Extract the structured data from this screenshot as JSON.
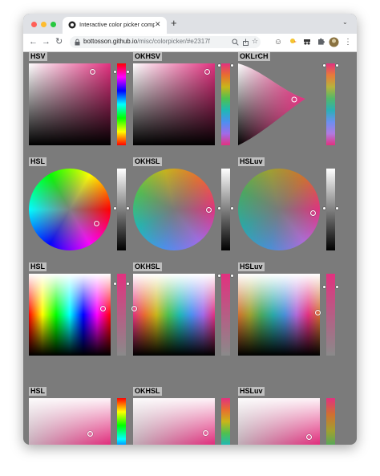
{
  "browser": {
    "tab_title": "Interactive color picker compa",
    "tab_close": "✕",
    "new_tab": "+",
    "tab_menu": "⌄",
    "url_host": "bottosson.github.io",
    "url_path": "/misc/colorpicker/#e2317f",
    "nav": {
      "back": "←",
      "forward": "→",
      "reload": "↻"
    },
    "icons": [
      "zoom-icon",
      "share-icon",
      "bookmark-star-icon",
      "smiley-extension-icon",
      "duck-extension-icon",
      "spy-extension-icon",
      "puzzle-extensions-icon",
      "avatar",
      "kebab-menu-icon"
    ]
  },
  "selected_color": "#e2317f",
  "rows": [
    {
      "panels": [
        {
          "label": "HSV"
        },
        {
          "label": "OKHSV"
        },
        {
          "label": "OKLrCH"
        }
      ]
    },
    {
      "panels": [
        {
          "label": "HSL"
        },
        {
          "label": "OKHSL"
        },
        {
          "label": "HSLuv"
        }
      ]
    },
    {
      "panels": [
        {
          "label": "HSL"
        },
        {
          "label": "OKHSL"
        },
        {
          "label": "HSLuv"
        }
      ]
    },
    {
      "panels": [
        {
          "label": "HSL"
        },
        {
          "label": "OKHSL"
        },
        {
          "label": "HSLuv"
        }
      ]
    }
  ]
}
